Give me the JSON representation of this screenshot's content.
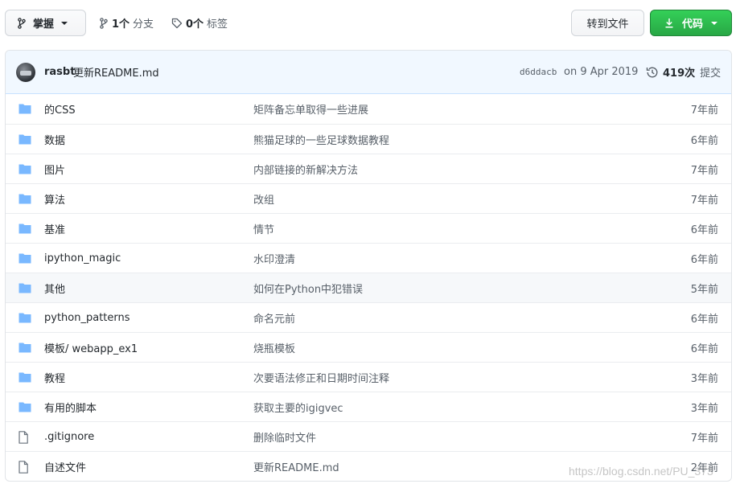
{
  "toolbar": {
    "branch_label": "掌握",
    "branches_count": "1个",
    "branches_label": "分支",
    "tags_count": "0个",
    "tags_label": "标签",
    "goto_file_label": "转到文件",
    "code_label": "代码"
  },
  "commit": {
    "author": "rasbt",
    "message": "更新README.md",
    "sha": "d6ddacb",
    "date": "on 9 Apr 2019",
    "history_count": "419次",
    "history_label": "提交"
  },
  "files": [
    {
      "type": "folder-icon",
      "name": "的CSS",
      "message": "矩阵备忘单取得一些进展",
      "age": "7年前"
    },
    {
      "type": "folder-icon",
      "name": "数据",
      "message": "熊猫足球的一些足球数据教程",
      "age": "6年前"
    },
    {
      "type": "folder-icon",
      "name": "图片",
      "message": "内部链接的新解决方法",
      "age": "7年前"
    },
    {
      "type": "folder-icon",
      "name": "算法",
      "message": "改组",
      "age": "7年前"
    },
    {
      "type": "folder-icon",
      "name": "基准",
      "message": "情节",
      "age": "6年前"
    },
    {
      "type": "folder-icon",
      "name": "ipython_magic",
      "message": "水印澄清",
      "age": "6年前"
    },
    {
      "type": "folder-icon",
      "name": "其他",
      "message": "如何在Python中犯错误",
      "age": "5年前"
    },
    {
      "type": "folder-icon",
      "name": "python_patterns",
      "message": "命名元前",
      "age": "6年前"
    },
    {
      "type": "folder-icon",
      "name": "模板/ webapp_ex1",
      "message": "烧瓶模板",
      "age": "6年前"
    },
    {
      "type": "folder-icon",
      "name": "教程",
      "message": "次要语法修正和日期时间注释",
      "age": "3年前"
    },
    {
      "type": "folder-icon",
      "name": "有用的脚本",
      "message": "获取主要的igigvec",
      "age": "3年前"
    },
    {
      "type": "file-icon",
      "name": ".gitignore",
      "message": "删除临时文件",
      "age": "7年前"
    },
    {
      "type": "file-icon",
      "name": "自述文件",
      "message": "更新README.md",
      "age": "2年前"
    }
  ],
  "watermark": "https://blog.csdn.net/PU_373",
  "colors": {
    "accent_green": "#28a745",
    "folder_blue": "#79b8ff",
    "header_bg": "#f1f8ff"
  }
}
